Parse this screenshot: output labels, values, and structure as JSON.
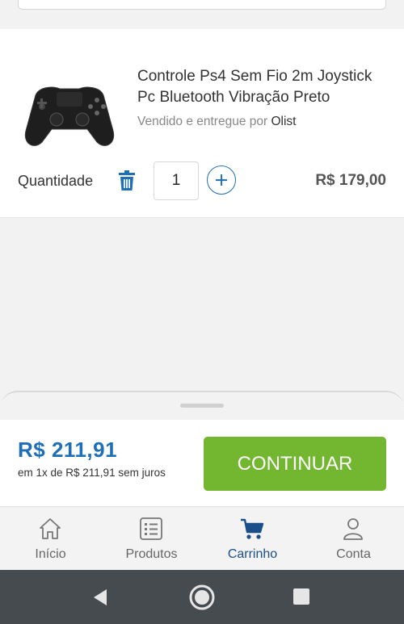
{
  "product": {
    "title": "Controle Ps4 Sem Fio 2m Joystick Pc Bluetooth Vibração Preto",
    "seller_prefix": "Vendido e entregue por",
    "seller_name": "Olist",
    "quantity_label": "Quantidade",
    "quantity": "1",
    "price": "R$ 179,00"
  },
  "summary": {
    "total": "R$ 211,91",
    "installments": "em 1x de R$ 211,91 sem juros",
    "continue_label": "CONTINUAR"
  },
  "nav": {
    "items": [
      {
        "label": "Início",
        "icon": "home-icon"
      },
      {
        "label": "Produtos",
        "icon": "list-icon"
      },
      {
        "label": "Carrinho",
        "icon": "cart-icon"
      },
      {
        "label": "Conta",
        "icon": "user-icon"
      }
    ],
    "active_index": 2
  },
  "colors": {
    "accent_blue": "#1f6fb8",
    "continue_green": "#72b72f",
    "system_bar": "#464b50"
  }
}
